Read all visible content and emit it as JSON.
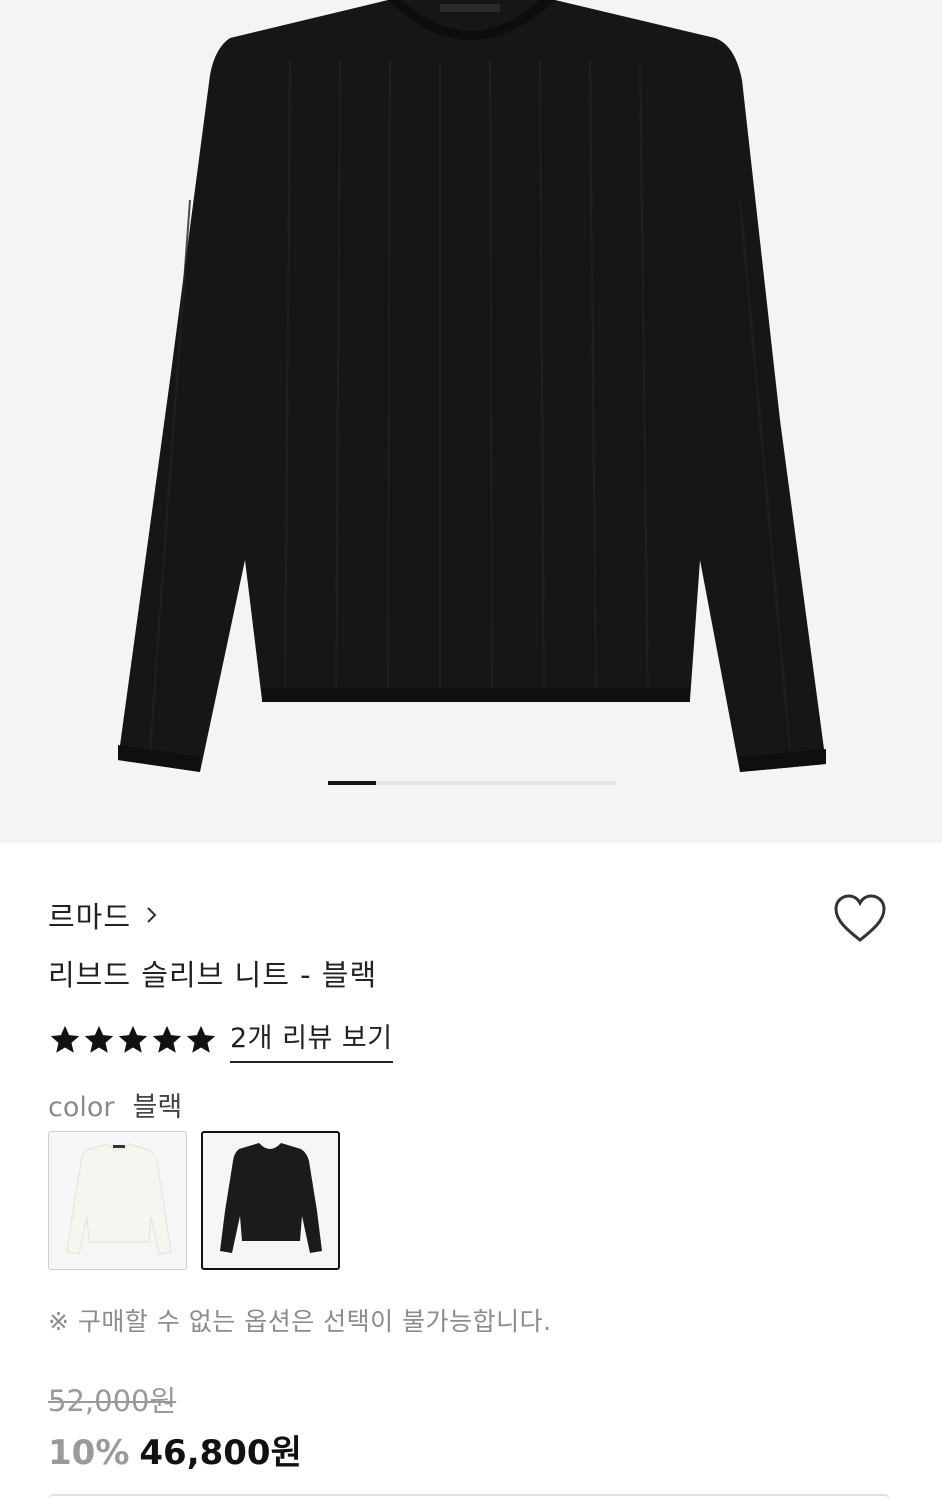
{
  "product": {
    "brand": "르마드",
    "title": "리브드 슬리브 니트 - 블랙",
    "rating_stars": 5,
    "review_link": "2개 리뷰 보기",
    "color_label": "color",
    "color_value": "블랙",
    "swatches": [
      {
        "name": "아이보리",
        "color": "#f3f1ea",
        "selected": false
      },
      {
        "name": "블랙",
        "color": "#1b1b1b",
        "selected": true
      }
    ],
    "notice": "※ 구매할 수 없는 옵션은 선택이 불가능합니다.",
    "original_price": "52,000원",
    "discount": "10%",
    "price": "46,800원"
  },
  "gallery": {
    "current_index": 1,
    "total_images": 6,
    "background": "#f4f4f4"
  },
  "icons": {
    "wishlist": "heart-icon",
    "brand_link": "chevron-right-icon",
    "star": "star-icon"
  },
  "colors": {
    "sweater_black": "#161616",
    "accent": "#111111",
    "muted_text": "#8c8c8c"
  }
}
